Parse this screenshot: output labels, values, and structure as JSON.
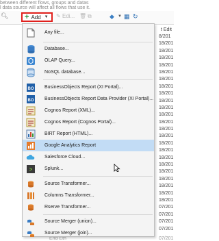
{
  "background": {
    "line1": "between different flows, groups and datas",
    "line2": "l data source will affect all flows that use it.",
    "rightcol_header": "t Edit",
    "rightcol_rows": [
      "8/201",
      "18/201",
      "18/201",
      "18/201",
      "18/201",
      "18/201",
      "18/201",
      "18/201",
      "18/201",
      "18/201",
      "18/201",
      "18/201",
      "18/201",
      "18/201",
      "18/201",
      "18/201",
      "18/201",
      "18/201",
      "18/201",
      "18/201",
      "18/201",
      "18/201",
      "18/201",
      "18/201",
      "07/201",
      "07/201",
      "07/201",
      "07/201"
    ],
    "bottom_text": "End Eth",
    "bottom_date": "07/201"
  },
  "toolbar": {
    "add_label": "Add",
    "edit_label": "Edi..."
  },
  "colors": {
    "highlight": "#c2dcf5",
    "add_border": "#e0201c"
  },
  "menu": {
    "items": [
      {
        "label": "Any file...",
        "icon": "file-icon"
      },
      {
        "label": "Database...",
        "icon": "database-icon"
      },
      {
        "label": "OLAP Query...",
        "icon": "olap-cube-icon"
      },
      {
        "label": "NoSQL database...",
        "icon": "nosql-icon"
      },
      {
        "label": "BusinessObjects Report (XI Portal)...",
        "icon": "bo-icon"
      },
      {
        "label": "BusinessObjects Report Data Provider (XI Portal)...",
        "icon": "bo-icon"
      },
      {
        "label": "Cognos Report (XML)...",
        "icon": "cognos-icon"
      },
      {
        "label": "Cognos Report (Cognos Portal)...",
        "icon": "cognos-icon"
      },
      {
        "label": "BIRT Report (HTML)...",
        "icon": "birt-icon"
      },
      {
        "label": "Google Analytics Report",
        "icon": "analytics-icon"
      },
      {
        "label": "Salesforce Cloud...",
        "icon": "salesforce-cloud-icon"
      },
      {
        "label": "Splunk...",
        "icon": "splunk-icon"
      },
      {
        "label": "Source Transformer...",
        "icon": "transformer-icon"
      },
      {
        "label": "Columns Transformer...",
        "icon": "columns-transformer-icon"
      },
      {
        "label": "Rserve Transformer...",
        "icon": "rserve-icon"
      },
      {
        "label": "Source Merger (union)...",
        "icon": "merger-union-icon"
      },
      {
        "label": "Source Merger (join)...",
        "icon": "merger-join-icon"
      }
    ]
  }
}
